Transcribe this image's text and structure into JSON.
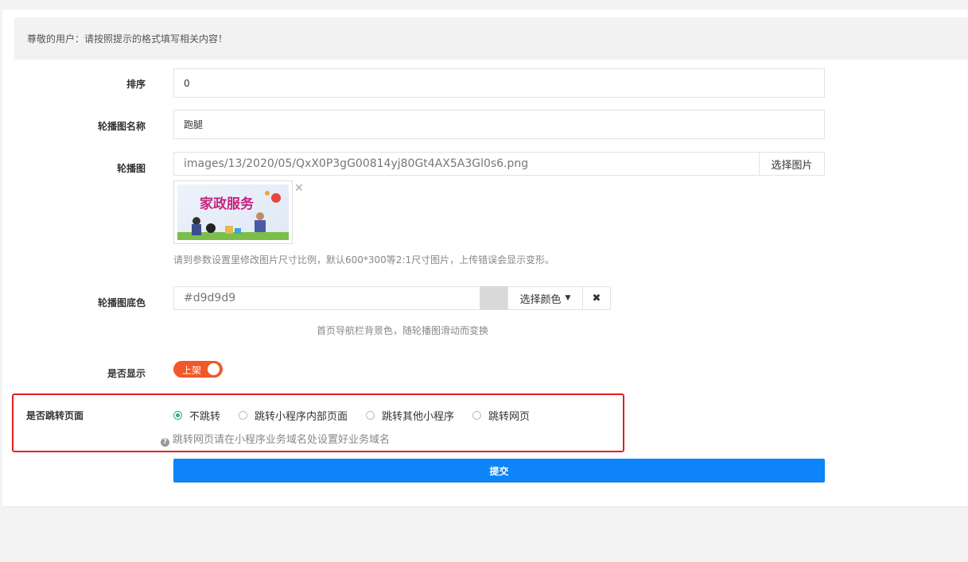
{
  "notice": "尊敬的用户：请按照提示的格式填写相关内容！",
  "fields": {
    "sort": {
      "label": "排序",
      "value": "0"
    },
    "name": {
      "label": "轮播图名称",
      "value": "跑腿"
    },
    "image": {
      "label": "轮播图",
      "value": "images/13/2020/05/QxX0P3gG00814yj80Gt4AX5A3Gl0s6.png",
      "button": "选择图片",
      "thumb_title": "家政服务",
      "help": "请到参数设置里修改图片尺寸比例，默认600*300等2:1尺寸图片，上传错误会显示变形。"
    },
    "bgcolor": {
      "label": "轮播图底色",
      "value": "#d9d9d9",
      "button": "选择颜色",
      "help": "首页导航栏背景色，随轮播图滑动而变换"
    },
    "show": {
      "label": "是否显示",
      "toggle_text": "上架",
      "on": true
    },
    "jump": {
      "label": "是否跳转页面",
      "options": [
        "不跳转",
        "跳转小程序内部页面",
        "跳转其他小程序",
        "跳转网页"
      ],
      "selected": 0,
      "help": "跳转网页请在小程序业务域名处设置好业务域名"
    }
  },
  "submit": "提交",
  "colors": {
    "primary": "#0d84f8",
    "toggle": "#f0582a",
    "highlight": "#e02020",
    "radio": "#2eb26b"
  }
}
